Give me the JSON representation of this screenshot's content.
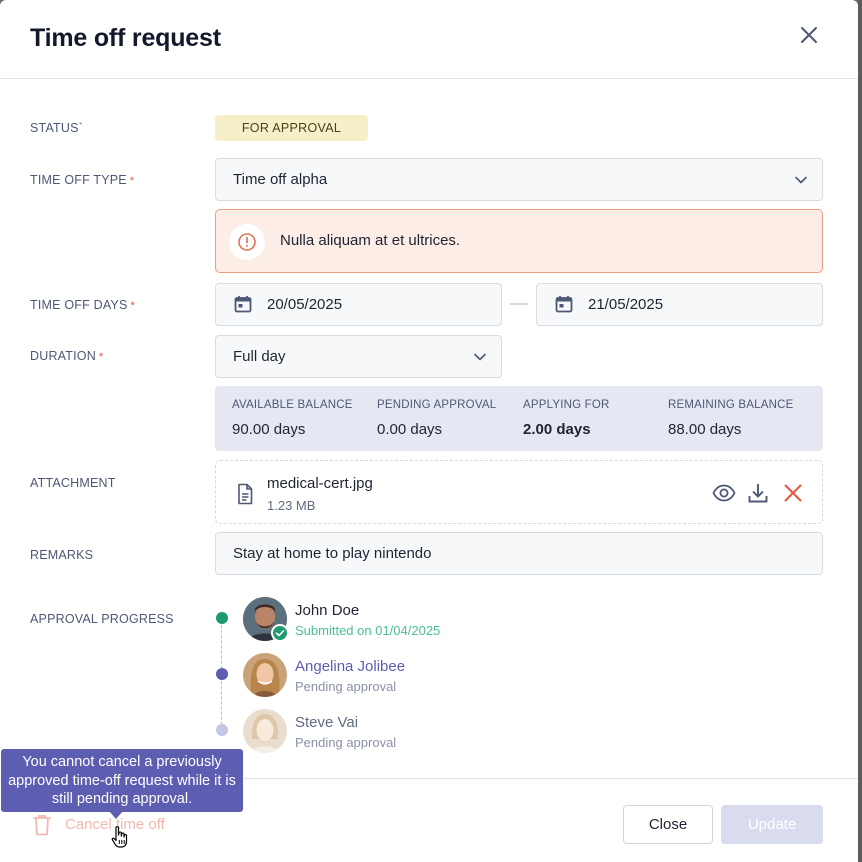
{
  "modal": {
    "title": "Time off request"
  },
  "labels": {
    "status": "STATUS`",
    "time_off_type": "TIME OFF TYPE",
    "time_off_days": "TIME OFF DAYS",
    "duration": "DURATION",
    "attachment": "ATTACHMENT",
    "remarks": "REMARKS",
    "approval_progress": "APPROVAL PROGRESS",
    "required_marker": "*"
  },
  "status": {
    "badge": "FOR APPROVAL",
    "color": "#f7efc7"
  },
  "time_off_type": {
    "value": "Time off alpha"
  },
  "alert": {
    "message": "Nulla aliquam at et ultrices.",
    "color": "#ec9e80"
  },
  "time_off_days": {
    "start": "20/05/2025",
    "end": "21/05/2025"
  },
  "duration": {
    "value": "Full day"
  },
  "balance": {
    "columns": [
      {
        "label": "AVAILABLE BALANCE",
        "value": "90.00 days"
      },
      {
        "label": "PENDING APPROVAL",
        "value": "0.00 days"
      },
      {
        "label": "APPLYING FOR",
        "value": "2.00 days"
      },
      {
        "label": "REMAINING BALANCE",
        "value": "88.00 days"
      }
    ]
  },
  "attachment": {
    "file_name": "medical-cert.jpg",
    "file_size": "1.23 MB",
    "actions": [
      "eye-icon",
      "download-icon",
      "delete-icon"
    ]
  },
  "remarks": {
    "value": "Stay at home to play nintendo"
  },
  "approval": {
    "steps": [
      {
        "name": "John Doe",
        "status": "Submitted on 01/04/2025",
        "state": "approved",
        "color": "#1e9a6e"
      },
      {
        "name": "Angelina Jolibee",
        "status": "Pending approval",
        "state": "current",
        "color": "#5d5db2"
      },
      {
        "name": "Steve Vai",
        "status": "Pending approval",
        "state": "upcoming",
        "color": "#b7bad8"
      }
    ]
  },
  "footer": {
    "cancel_label": "Cancel time off",
    "close_label": "Close",
    "update_label": "Update"
  },
  "tooltip": {
    "text": "You cannot cancel a previously approved time-off request while it is still pending approval."
  },
  "colors": {
    "accent": "#5d5db2",
    "success": "#1e9a6e",
    "danger": "#e2553f"
  }
}
